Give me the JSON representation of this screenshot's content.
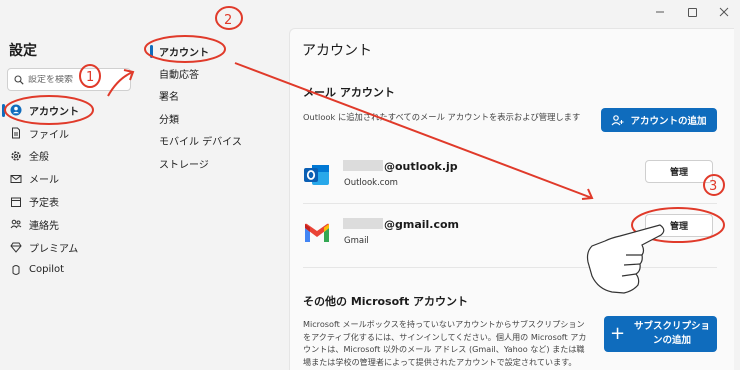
{
  "window": {
    "controls": [
      "minimize-icon",
      "maximize-icon",
      "close-icon"
    ]
  },
  "sidebar": {
    "title": "設定",
    "search_placeholder": "設定を検索",
    "items": [
      {
        "label": "アカウント",
        "icon": "person-icon",
        "active": true
      },
      {
        "label": "ファイル",
        "icon": "file-icon"
      },
      {
        "label": "全般",
        "icon": "gear-icon"
      },
      {
        "label": "メール",
        "icon": "mail-icon"
      },
      {
        "label": "予定表",
        "icon": "calendar-icon"
      },
      {
        "label": "連絡先",
        "icon": "people-icon"
      },
      {
        "label": "プレミアム",
        "icon": "diamond-icon"
      },
      {
        "label": "Copilot",
        "icon": "copilot-icon"
      }
    ]
  },
  "subnav": {
    "items": [
      {
        "label": "アカウント",
        "active": true
      },
      {
        "label": "自動応答"
      },
      {
        "label": "署名"
      },
      {
        "label": "分類"
      },
      {
        "label": "モバイル デバイス"
      },
      {
        "label": "ストレージ"
      }
    ]
  },
  "main": {
    "title": "アカウント",
    "mail_accounts": {
      "heading": "メール アカウント",
      "description": "Outlook に追加されたすべてのメール アカウントを表示および管理します",
      "add_button": "アカウントの追加",
      "accounts": [
        {
          "email": "@outlook.jp",
          "type": "Outlook.com",
          "logo": "outlook-logo-icon",
          "manage_label": "管理"
        },
        {
          "email": "@gmail.com",
          "type": "Gmail",
          "logo": "gmail-logo-icon",
          "manage_label": "管理"
        }
      ]
    },
    "other_accounts": {
      "heading": "その他の Microsoft アカウント",
      "description": "Microsoft メールボックスを持っていないアカウントからサブスクリプションをアクティブ化するには、サインインしてください。個人用の Microsoft アカウントは、Microsoft 以外のメール アドレス (Gmail、Yahoo など) または職場または学校の管理者によって提供されたアカウントで設定されています。",
      "add_button": "サブスクリプションの追加"
    }
  },
  "annotations": {
    "step1": "1",
    "step2": "2",
    "step3": "3",
    "color": "#e03a2a"
  }
}
